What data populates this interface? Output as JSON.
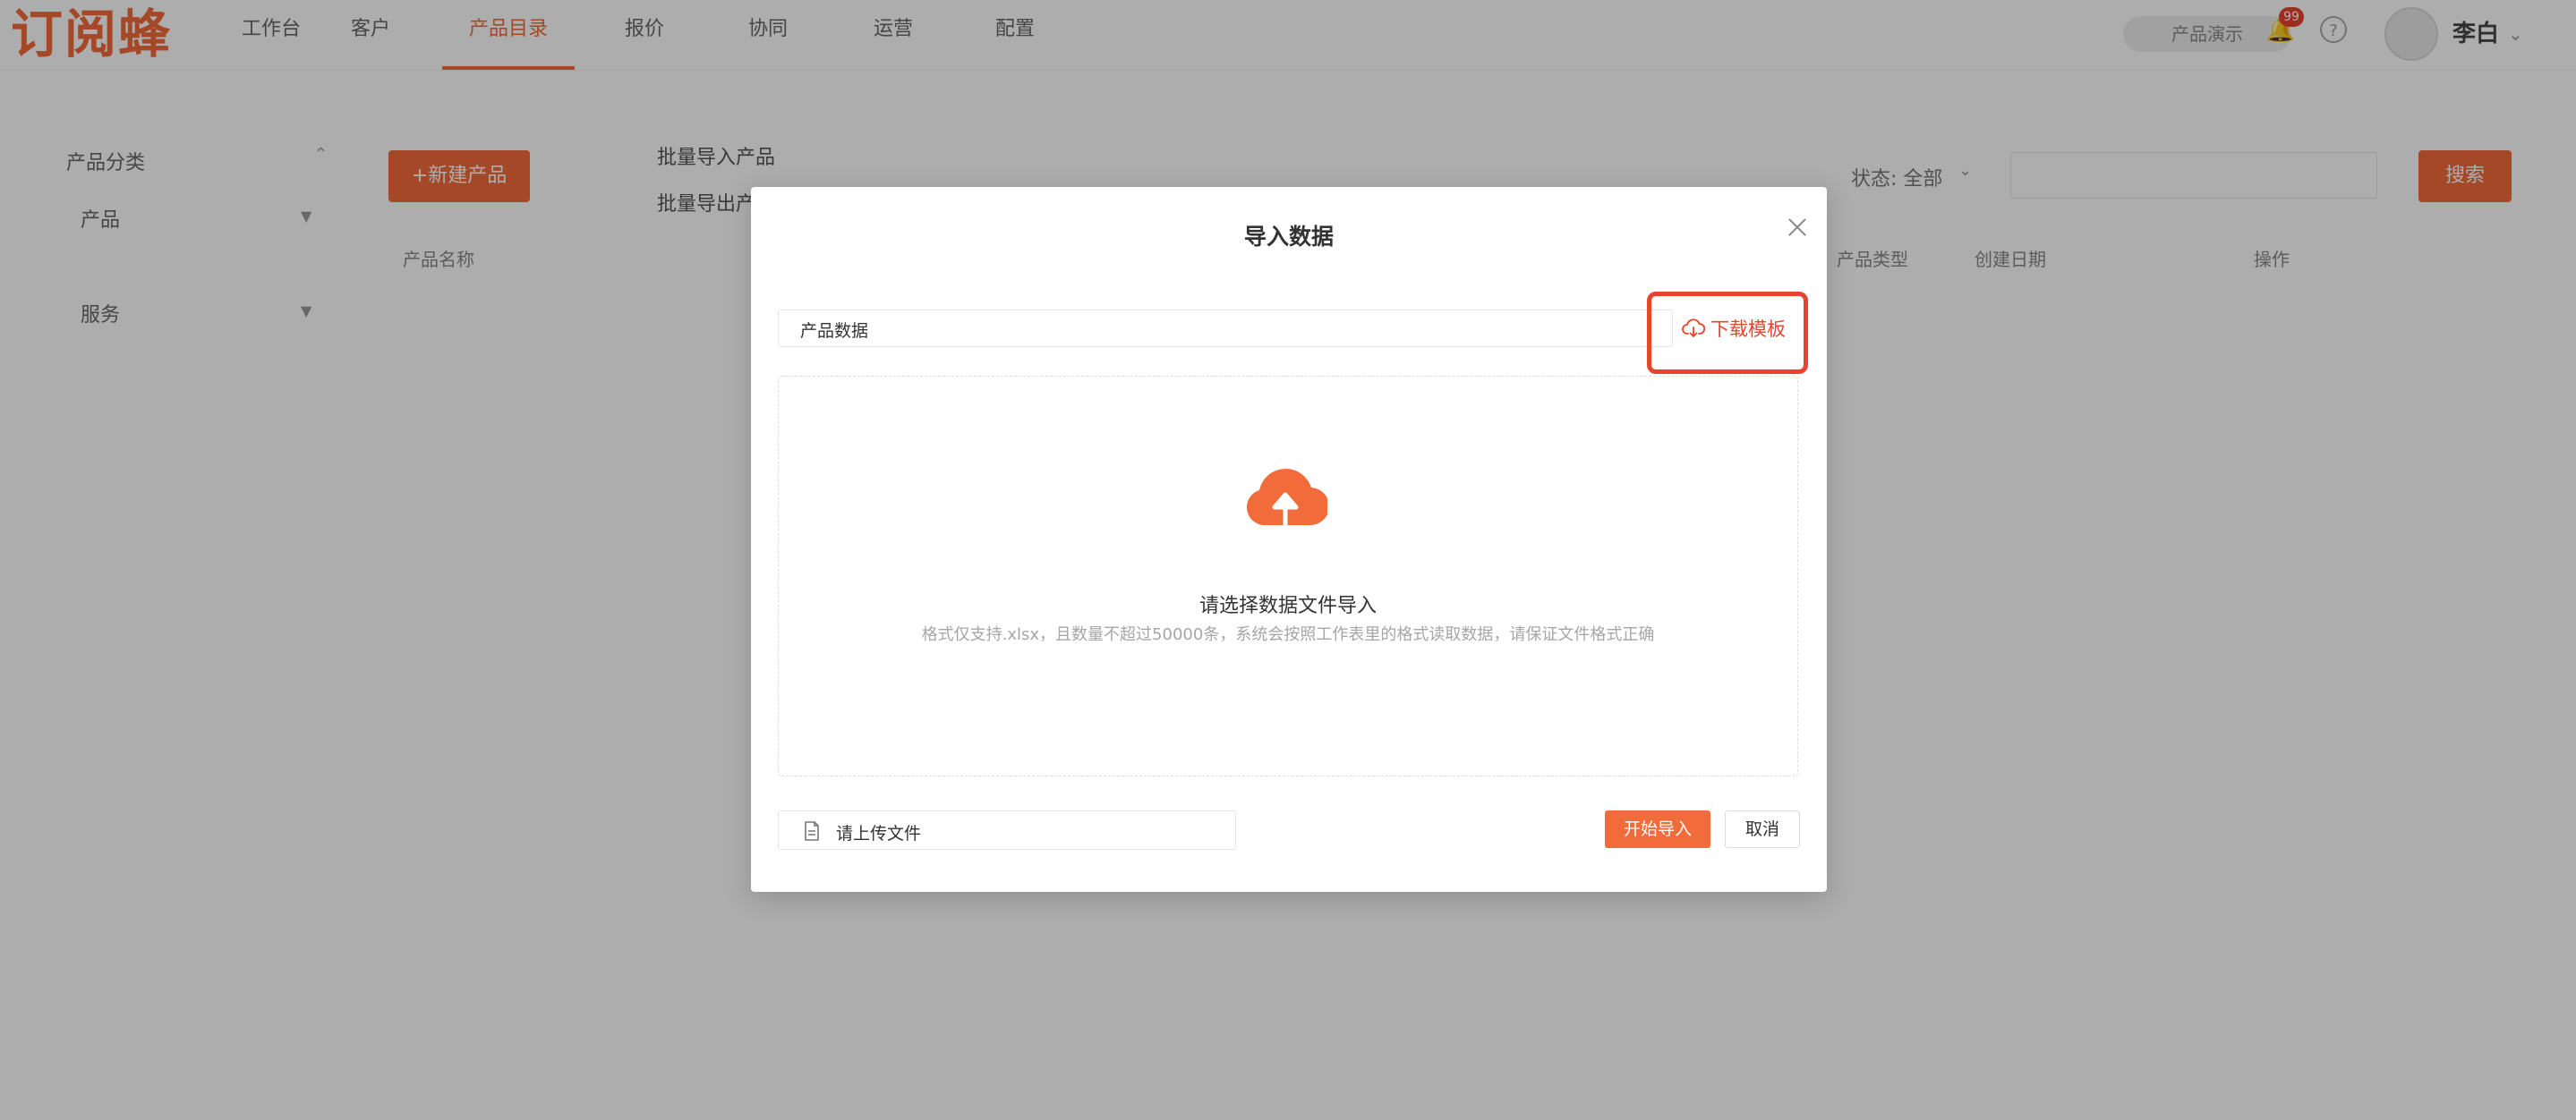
{
  "app": {
    "logo_text": "订阅蜂",
    "nav": [
      {
        "label": "工作台"
      },
      {
        "label": "客户"
      },
      {
        "label": "产品目录"
      },
      {
        "label": "报价"
      },
      {
        "label": "协同"
      },
      {
        "label": "运营"
      },
      {
        "label": "配置"
      }
    ],
    "top_right": {
      "pill_label": "产品演示",
      "badge_count": "99",
      "help_glyph": "?",
      "username": "李白"
    }
  },
  "sidebar": {
    "heading": "产品分类",
    "items": [
      {
        "label": "产品"
      },
      {
        "label": "服务"
      }
    ]
  },
  "main": {
    "add_button": "+新建产品",
    "links": [
      "批量导入产品",
      "批量导出产品"
    ],
    "filter_label": "状态: 全部",
    "search_button": "搜索",
    "columns": [
      "产品名称",
      "产品类型",
      "创建日期",
      "操作"
    ]
  },
  "modal": {
    "title": "导入数据",
    "select_value": "产品数据",
    "download_label": "下载模板",
    "drop_title": "请选择数据文件导入",
    "drop_hint": "格式仅支持.xlsx，且数量不超过50000条，系统会按照工作表里的格式读取数据，请保证文件格式正确",
    "file_placeholder": "请上传文件",
    "start_button": "开始导入",
    "cancel_button": "取消"
  },
  "colors": {
    "accent": "#f26b3a",
    "highlight": "#e8432e",
    "overlay": "rgba(0,0,0,0.32)"
  },
  "icons": {
    "download": "cloud-download-icon",
    "upload": "cloud-upload-icon",
    "file": "file-icon",
    "close": "close-icon"
  }
}
